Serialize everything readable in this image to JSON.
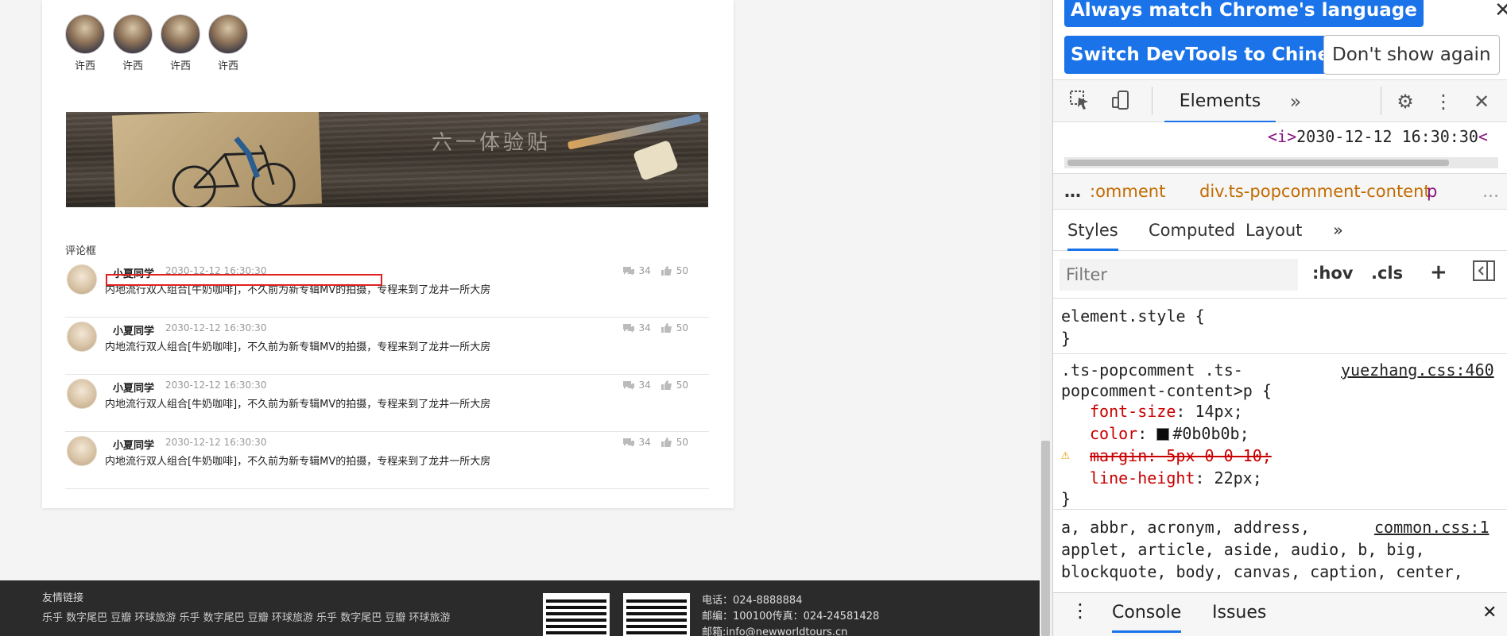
{
  "avatars": [
    {
      "name": "许西"
    },
    {
      "name": "许西"
    },
    {
      "name": "许西"
    },
    {
      "name": "许西"
    }
  ],
  "banner": {
    "title": "六一体验贴"
  },
  "comments_section": {
    "title": "评论框",
    "items": [
      {
        "user": "小夏同学",
        "time": "2030-12-12 16:30:30",
        "text": "内地流行双人组合[牛奶咖啡]，不久前为新专辑MV的拍摄，专程来到了龙井一所大房",
        "comments": "34",
        "likes": "50"
      },
      {
        "user": "小夏同学",
        "time": "2030-12-12 16:30:30",
        "text": "内地流行双人组合[牛奶咖啡]，不久前为新专辑MV的拍摄，专程来到了龙井一所大房",
        "comments": "34",
        "likes": "50"
      },
      {
        "user": "小夏同学",
        "time": "2030-12-12 16:30:30",
        "text": "内地流行双人组合[牛奶咖啡]，不久前为新专辑MV的拍摄，专程来到了龙井一所大房",
        "comments": "34",
        "likes": "50"
      },
      {
        "user": "小夏同学",
        "time": "2030-12-12 16:30:30",
        "text": "内地流行双人组合[牛奶咖啡]，不久前为新专辑MV的拍摄，专程来到了龙井一所大房",
        "comments": "34",
        "likes": "50"
      }
    ]
  },
  "footer": {
    "links_title": "友情链接",
    "links": "乐乎 数字尾巴 豆瓣 环球旅游 乐乎 数字尾巴 豆瓣 环球旅游 乐乎 数字尾巴 豆瓣 环球旅游",
    "phone": "电话：024-8888884",
    "postal": "邮编：100100传真：024-24581428",
    "email": "邮箱:info@newworldtours.cn"
  },
  "devtools": {
    "banner_match": "Always match Chrome's language",
    "banner_switch": "Switch DevTools to Chinese",
    "banner_dismiss": "Don't show again",
    "main_tab": "Elements",
    "dom_line_text": "2030-12-12 16:30:30",
    "dom_open_tag": "<i>",
    "dom_close_tag": "<",
    "crumbs": {
      "ellipsis": "…",
      "c1": ":omment",
      "c2": "div.ts-popcomment-content",
      "c3": "p",
      "more": "…"
    },
    "subtabs": {
      "styles": "Styles",
      "computed": "Computed",
      "layout": "Layout",
      "more": "»"
    },
    "filter": {
      "placeholder": "Filter",
      "hov": ":hov",
      "cls": ".cls",
      "plus": "+"
    },
    "rules": {
      "element_style": "element.style {",
      "close": "}",
      "selector_1": ".ts-popcomment .ts-",
      "selector_2": "popcomment-content>p {",
      "source": "yuezhang.css:460",
      "font_size_prop": "font-size",
      "font_size_val": "14px;",
      "color_prop": "color",
      "color_val": "#0b0b0b;",
      "margin_line": "margin: 5px 0 0 10;",
      "line_height_prop": "line-height",
      "line_height_val": "22px;",
      "ua_line1": "a, abbr, acronym, address,",
      "ua_source": "common.css:1",
      "ua_line2": "applet, article, aside, audio, b, big,",
      "ua_line3": "blockquote, body, canvas, caption, center,"
    },
    "drawer": {
      "console": "Console",
      "issues": "Issues"
    },
    "colors": {
      "accent": "#1a73e8",
      "swatch": "#0b0b0b"
    }
  }
}
